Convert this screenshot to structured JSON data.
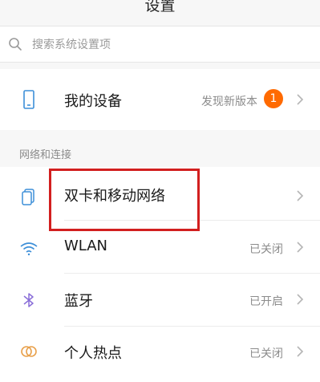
{
  "header": {
    "title": "设置"
  },
  "search": {
    "placeholder": "搜索系统设置项"
  },
  "my_device": {
    "label": "我的设备",
    "status": "发现新版本",
    "badge": "1"
  },
  "section": {
    "label": "网络和连接"
  },
  "items": [
    {
      "label": "双卡和移动网络",
      "status": ""
    },
    {
      "label": "WLAN",
      "status": "已关闭"
    },
    {
      "label": "蓝牙",
      "status": "已开启"
    },
    {
      "label": "个人热点",
      "status": "已关闭"
    }
  ],
  "colors": {
    "accent": "#ff6a00",
    "highlight": "#d21f1f",
    "icon": "#3d8fd8"
  }
}
